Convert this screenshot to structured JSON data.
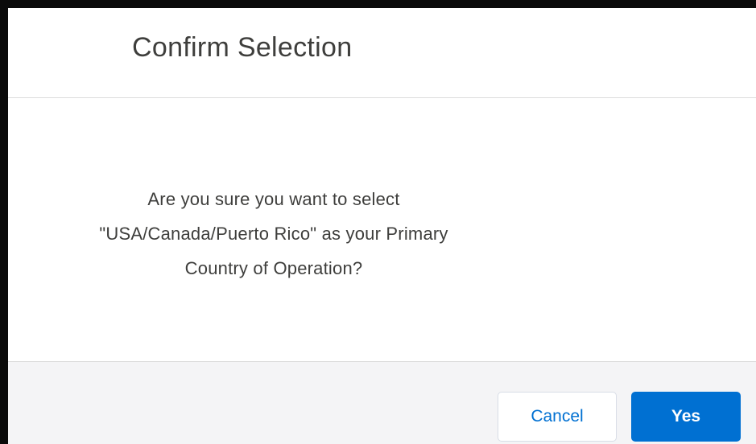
{
  "modal": {
    "title": "Confirm Selection",
    "message_lines": [
      "Are you sure you want to select",
      "\"USA/Canada/Puerto Rico\" as your Primary",
      "Country of Operation?"
    ],
    "buttons": {
      "cancel_label": "Cancel",
      "yes_label": "Yes"
    }
  },
  "colors": {
    "brand_blue": "#0070d2",
    "footer_background": "#f4f4f6",
    "text": "#3e3e3c",
    "frame": "#0a0a0a"
  }
}
